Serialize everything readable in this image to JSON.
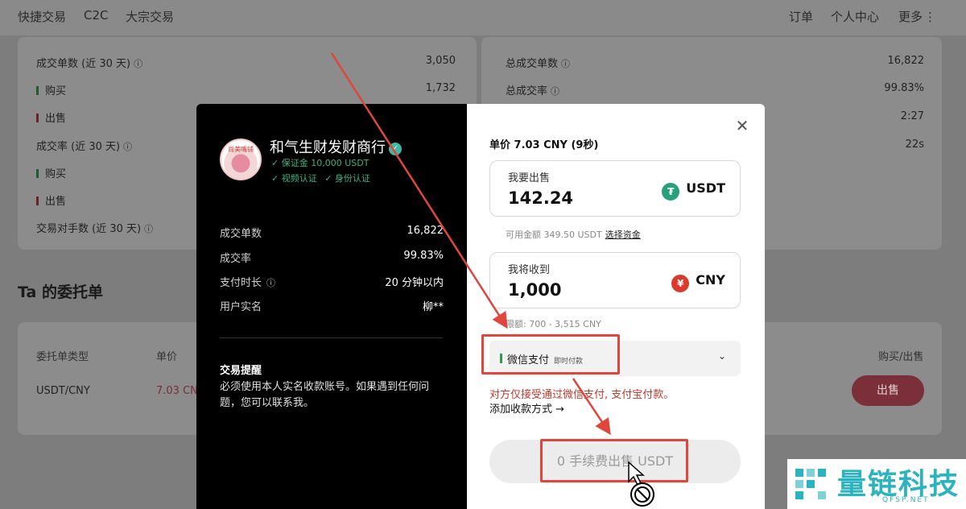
{
  "topnav": {
    "left": [
      "快捷交易",
      "C2C",
      "大宗交易"
    ],
    "right": [
      "订单",
      "个人中心",
      "更多"
    ]
  },
  "bg_stats_left": [
    {
      "label": "成交单数 (近 30 天)",
      "value": "3,050"
    },
    {
      "label": "购买",
      "value": "1,732"
    },
    {
      "label": "出售",
      "value": ""
    },
    {
      "label": "成交率 (近 30 天)",
      "value": ""
    },
    {
      "label": "购买",
      "value": ""
    },
    {
      "label": "出售",
      "value": ""
    },
    {
      "label": "交易对手数 (近 30 天)",
      "value": ""
    }
  ],
  "bg_stats_right": [
    {
      "label": "总成交单数",
      "value": "16,822"
    },
    {
      "label": "总成交率",
      "value": "99.83%"
    },
    {
      "label": "",
      "value": "2:27"
    },
    {
      "label": "",
      "value": "22s"
    }
  ],
  "orders": {
    "title": "Ta 的委托单",
    "headers": {
      "type": "委托单类型",
      "price": "单价",
      "action": "购买/出售"
    },
    "row": {
      "pair": "USDT/CNY",
      "price": "7.03 CN",
      "button": "出售"
    }
  },
  "merchant": {
    "avatar_text": "尚美嘴铺",
    "name": "和气生财发财商行",
    "badges": [
      "✓ 保证金 10,000 USDT",
      "✓ 视频认证",
      "✓ 身份认证"
    ],
    "stats": [
      {
        "label": "成交单数",
        "value": "16,822"
      },
      {
        "label": "成交率",
        "value": "99.83%"
      },
      {
        "label": "支付时长",
        "value": "20 分钟以内"
      },
      {
        "label": "用户实名",
        "value": "柳**"
      }
    ],
    "notice_title": "交易提醒",
    "notice_text": "必须使用本人实名收款账号。如果遇到任何问题，您可以联系我。"
  },
  "trade": {
    "price_line": "单价 7.03 CNY (9秒)",
    "sell_label": "我要出售",
    "sell_amount": "142.24",
    "sell_currency": "USDT",
    "available_text": "可用金额 349.50 USDT",
    "select_funds": "选择资金",
    "receive_label": "我将收到",
    "receive_amount": "1,000",
    "receive_currency": "CNY",
    "limit_text": "限额: 700 - 3,515 CNY",
    "payment_method": "微信支付",
    "payment_tag": "即时付款",
    "warning": "对方仅接受通过微信支付, 支付宝付款。",
    "add_payment": "添加收款方式 →",
    "submit": "0 手续费出售 USDT"
  },
  "watermark": {
    "title": "量链科技",
    "sub": "QFSP.NET"
  },
  "colors": {
    "accent_red": "#e0453e",
    "sell_btn": "#7a2f39",
    "wm": "#2bb3c0"
  }
}
